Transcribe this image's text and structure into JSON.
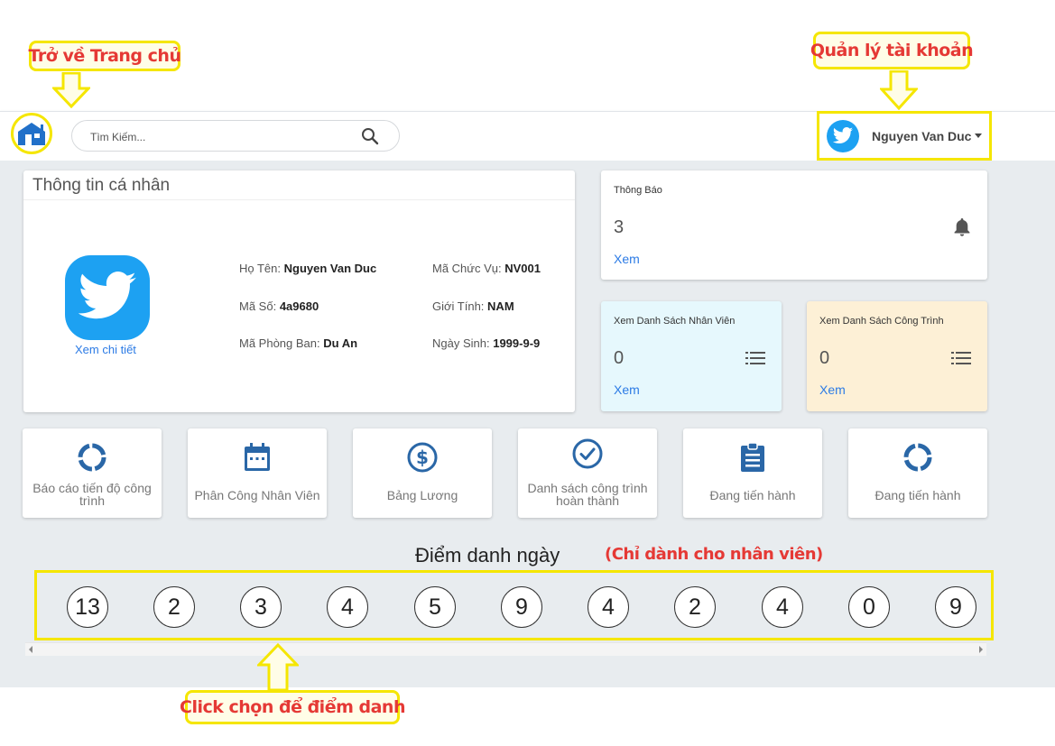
{
  "annotations": {
    "home_callout": "Trở về Trang chủ",
    "account_callout": "Quản lý tài khoản",
    "attendance_callout": "Click chọn để điểm danh",
    "attendance_note": "(Chỉ dành cho nhân viên)"
  },
  "header": {
    "search_placeholder": "Tìm Kiếm...",
    "username": "Nguyen Van Duc"
  },
  "profile": {
    "title": "Thông tin cá nhân",
    "detail_link": "Xem chi tiết",
    "fields": [
      {
        "label": "Họ Tên:",
        "value": "Nguyen Van Duc"
      },
      {
        "label": "Mã Chức Vụ:",
        "value": "NV001"
      },
      {
        "label": "Mã Số:",
        "value": "4a9680"
      },
      {
        "label": "Giới Tính:",
        "value": "NAM"
      },
      {
        "label": "Mã Phòng Ban:",
        "value": "Du An"
      },
      {
        "label": "Ngày Sinh:",
        "value": "1999-9-9"
      }
    ]
  },
  "stats": {
    "notifications": {
      "title": "Thông Báo",
      "count": "3",
      "link": "Xem"
    },
    "employees": {
      "title": "Xem Danh Sách Nhân Viên",
      "count": "0",
      "link": "Xem"
    },
    "projects": {
      "title": "Xem Danh Sách Công Trình",
      "count": "0",
      "link": "Xem"
    }
  },
  "tiles": [
    {
      "label": "Báo cáo tiến độ công trình",
      "icon": "progress-ring-icon"
    },
    {
      "label": "Phân Công Nhân Viên",
      "icon": "calendar-icon"
    },
    {
      "label": "Bảng Lương",
      "icon": "dollar-icon"
    },
    {
      "label": "Danh sách công trình hoàn thành",
      "icon": "check-circle-icon"
    },
    {
      "label": "Đang tiến hành",
      "icon": "clipboard-icon"
    },
    {
      "label": "Đang tiến hành",
      "icon": "progress-ring-icon"
    }
  ],
  "attendance": {
    "title": "Điểm danh ngày",
    "days": [
      "13",
      "2",
      "3",
      "4",
      "5",
      "9",
      "4",
      "2",
      "4",
      "0",
      "9"
    ]
  },
  "colors": {
    "accent": "#2c7be5",
    "twitter_blue": "#1da1f2",
    "annotation_yellow": "#f5e600",
    "annotation_red": "#e53935",
    "employees_card_bg": "#e6f8fd",
    "projects_card_bg": "#fdf0d6",
    "tile_icon_blue": "#2a67a7"
  }
}
